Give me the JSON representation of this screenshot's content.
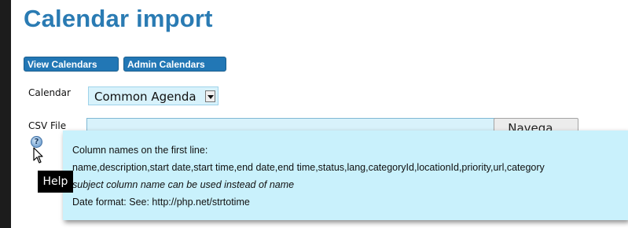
{
  "page": {
    "title": "Calendar import"
  },
  "nav": {
    "view_calendars": "View Calendars",
    "admin_calendars": "Admin Calendars"
  },
  "form": {
    "calendar_label": "Calendar",
    "calendar_value": "Common Agenda",
    "csv_label": "CSV File",
    "csv_value": "",
    "browse_label": "Navega..."
  },
  "help": {
    "icon": "help-question-icon",
    "tooltip": "Help",
    "lines": [
      "Column names on the first line:",
      "name,description,start date,start time,end date,end time,status,lang,categoryId,locationId,priority,url,category",
      "subject column name can be used instead of name",
      "Date format: See: http://php.net/strtotime"
    ]
  }
}
